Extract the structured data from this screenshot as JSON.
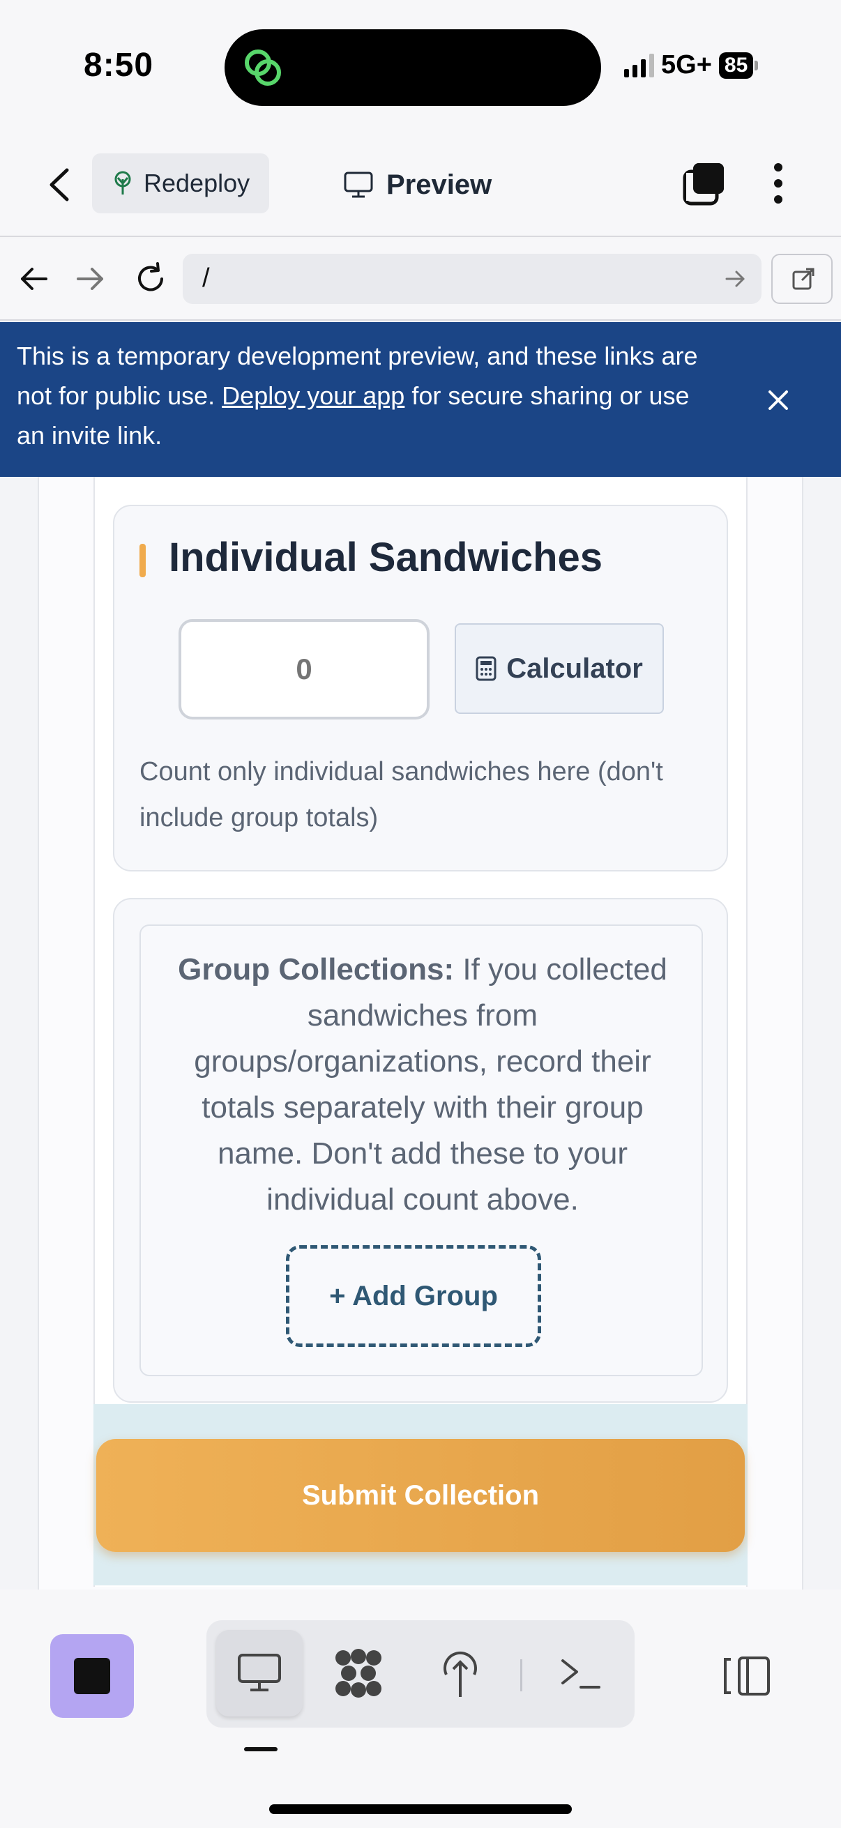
{
  "status_bar": {
    "time": "8:50",
    "network": "5G+",
    "battery": "85"
  },
  "header": {
    "redeploy_label": "Redeploy",
    "preview_label": "Preview"
  },
  "url_bar": {
    "value": "/"
  },
  "banner": {
    "text_before": "This is a temporary development preview, and these links are not for public use. ",
    "link_text": "Deploy your app",
    "text_after": " for secure sharing or use an invite link."
  },
  "individual": {
    "title": "Individual Sandwiches",
    "count_value": "0",
    "calculator_label": "Calculator",
    "help_text": "Count only individual sandwiches here (don't include group totals)"
  },
  "groups": {
    "heading": "Group Collections:",
    "text": " If you collected sandwiches from groups/organizations, record their totals separately with their group name. Don't add these to your individual count above.",
    "add_button": "+ Add Group"
  },
  "submit": {
    "label": "Submit Collection"
  },
  "toolbar": {
    "active_tool": "preview"
  },
  "colors": {
    "banner_bg": "#1b4586",
    "accent": "#f0ab4d",
    "submit_bg": "#e9a84f",
    "stop_btn": "#b4a5f2",
    "group_button": "#2f5874"
  }
}
